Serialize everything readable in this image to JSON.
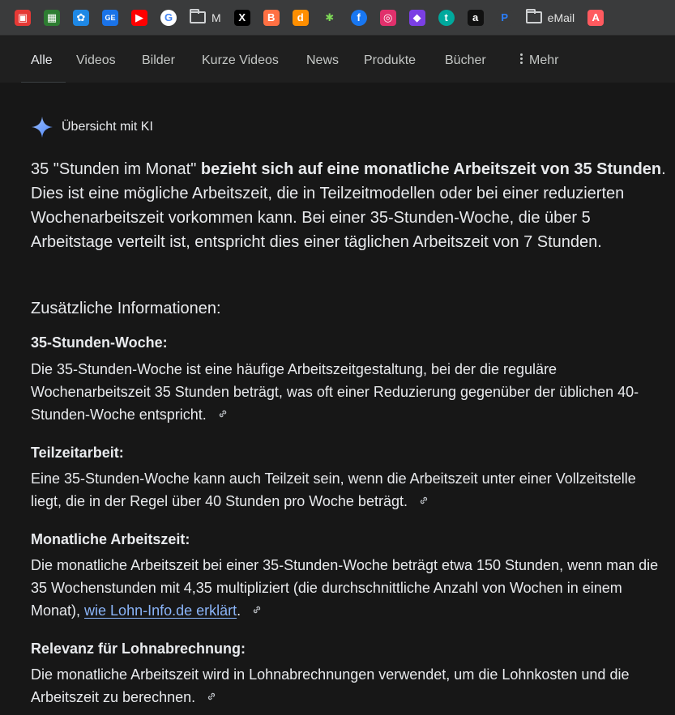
{
  "bookmarks": [
    {
      "name": "bookmark-1",
      "label": "",
      "color": "#e53935",
      "glyph": "▣"
    },
    {
      "name": "bookmark-2",
      "label": "",
      "color": "#2e7d32",
      "glyph": "▦"
    },
    {
      "name": "bookmark-3",
      "label": "",
      "color": "#1e88e5",
      "glyph": "✿"
    },
    {
      "name": "bookmark-4",
      "label": "",
      "color": "#1a73e8",
      "glyph": "GE"
    },
    {
      "name": "bookmark-youtube",
      "label": "",
      "color": "#ff0000",
      "glyph": "▶"
    },
    {
      "name": "bookmark-google",
      "label": "",
      "color": "#ffffff",
      "glyph": "G"
    },
    {
      "name": "bookmark-folder-m",
      "label": "M",
      "color": "",
      "glyph": "folder"
    },
    {
      "name": "bookmark-x",
      "label": "",
      "color": "#000000",
      "glyph": "X"
    },
    {
      "name": "bookmark-blogger",
      "label": "",
      "color": "#ff7043",
      "glyph": "B"
    },
    {
      "name": "bookmark-d",
      "label": "",
      "color": "#ff8f00",
      "glyph": "d"
    },
    {
      "name": "bookmark-green",
      "label": "",
      "color": "#3a3b3c",
      "glyph": "✱"
    },
    {
      "name": "bookmark-facebook",
      "label": "",
      "color": "#1877f2",
      "glyph": "f"
    },
    {
      "name": "bookmark-instagram",
      "label": "",
      "color": "#e1306c",
      "glyph": "◎"
    },
    {
      "name": "bookmark-purple",
      "label": "",
      "color": "#7b3fe4",
      "glyph": "◆"
    },
    {
      "name": "bookmark-t",
      "label": "",
      "color": "#00a99d",
      "glyph": "t"
    },
    {
      "name": "bookmark-amazon",
      "label": "",
      "color": "#111111",
      "glyph": "a"
    },
    {
      "name": "bookmark-paypal",
      "label": "",
      "color": "#3a3b3c",
      "glyph": "P"
    },
    {
      "name": "bookmark-folder-email",
      "label": "eMail",
      "color": "",
      "glyph": "folder"
    },
    {
      "name": "bookmark-airbnb",
      "label": "",
      "color": "#ff5a5f",
      "glyph": "A"
    }
  ],
  "tabs": [
    {
      "label": "Alle",
      "active": true
    },
    {
      "label": "Videos"
    },
    {
      "label": "Bilder"
    },
    {
      "label": "Kurze Videos"
    },
    {
      "label": "News"
    },
    {
      "label": "Produkte"
    },
    {
      "label": "Bücher"
    },
    {
      "label": "Mehr"
    }
  ],
  "ai": {
    "header": "Übersicht mit KI",
    "lead_pre": "35 \"Stunden im Monat\" ",
    "lead_bold": "bezieht sich auf eine monatliche Arbeitszeit von 35 Stunden",
    "lead_post": ". Dies ist eine mögliche Arbeitszeit, die in Teilzeitmodellen oder bei einer reduzierten Wochenarbeitszeit vorkommen kann. Bei einer 35-Stunden-Woche, die über 5 Arbeitstage verteilt ist, entspricht dies einer täglichen Arbeitszeit von 7 Stunden.",
    "section_title": "Zusätzliche Informationen:",
    "items": [
      {
        "title": "35-Stunden-Woche:",
        "text": "Die 35-Stunden-Woche ist eine häufige Arbeitszeitgestaltung, bei der die reguläre Wochenarbeitszeit 35 Stunden beträgt, was oft einer Reduzierung gegenüber der üblichen 40-Stunden-Woche entspricht."
      },
      {
        "title": "Teilzeitarbeit:",
        "text": "Eine 35-Stunden-Woche kann auch Teilzeit sein, wenn die Arbeitszeit unter einer Vollzeitstelle liegt, die in der Regel über 40 Stunden pro Woche beträgt."
      },
      {
        "title": "Monatliche Arbeitszeit:",
        "text": "Die monatliche Arbeitszeit bei einer 35-Stunden-Woche beträgt etwa 150 Stunden, wenn man die 35 Wochenstunden mit 4,35 multipliziert (die durchschnittliche Anzahl von Wochen in einem Monat), ",
        "link": "wie Lohn-Info.de erklärt",
        "after": "."
      },
      {
        "title": "Relevanz für Lohnabrechnung:",
        "text": "Die monatliche Arbeitszeit wird in Lohnabrechnungen verwendet, um die Lohnkosten und die Arbeitszeit zu berechnen."
      }
    ]
  }
}
